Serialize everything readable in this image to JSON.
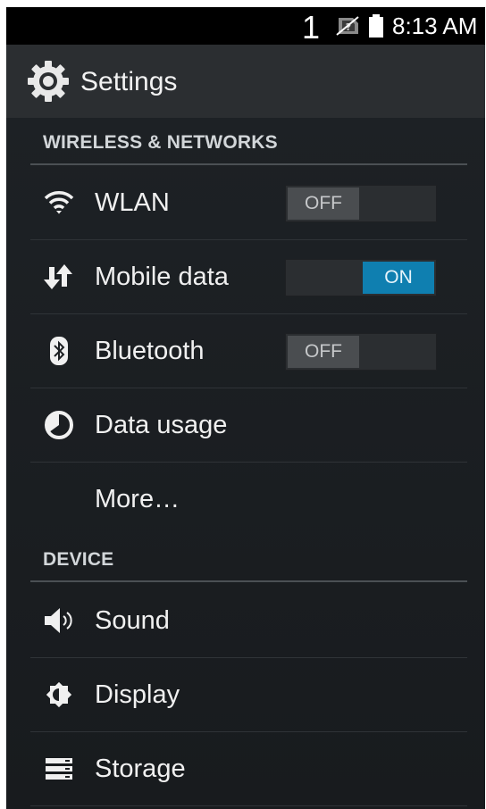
{
  "status_bar": {
    "sim_slot": "1",
    "time": "8:13 AM",
    "icons": [
      "no-sim-icon",
      "battery-icon"
    ]
  },
  "action_bar": {
    "title": "Settings",
    "icon": "gear-icon"
  },
  "sections": {
    "wireless": {
      "header": "WIRELESS & NETWORKS",
      "items": [
        {
          "label": "WLAN",
          "icon": "wifi-icon",
          "toggle": "OFF"
        },
        {
          "label": "Mobile data",
          "icon": "data-transfer-icon",
          "toggle": "ON"
        },
        {
          "label": "Bluetooth",
          "icon": "bluetooth-icon",
          "toggle": "OFF"
        },
        {
          "label": "Data usage",
          "icon": "data-usage-icon"
        },
        {
          "label": "More…"
        }
      ]
    },
    "device": {
      "header": "DEVICE",
      "items": [
        {
          "label": "Sound",
          "icon": "speaker-icon"
        },
        {
          "label": "Display",
          "icon": "brightness-icon"
        },
        {
          "label": "Storage",
          "icon": "storage-icon"
        }
      ]
    }
  },
  "colors": {
    "accent_on": "#0f7fb0",
    "toggle_off": "#4a4d50",
    "background": "#1c1f22",
    "status_bar": "#000000"
  }
}
